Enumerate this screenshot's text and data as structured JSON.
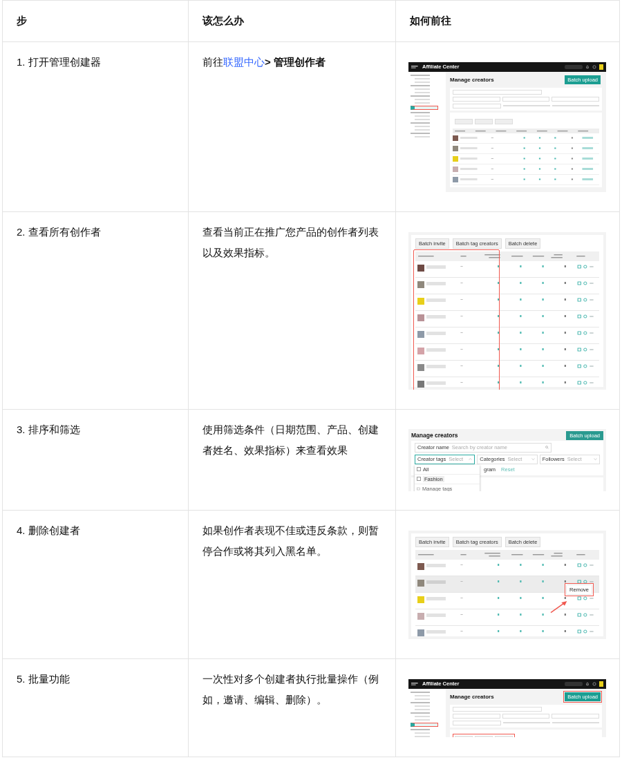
{
  "columns": [
    "步",
    "该怎么办",
    "如何前往"
  ],
  "rows": [
    {
      "step": "1. 打开管理创建器",
      "instruction": [
        {
          "kind": "text",
          "text": "前往"
        },
        {
          "kind": "link",
          "text": "联盟中心"
        },
        {
          "kind": "bold",
          "text": "> 管理创作者"
        }
      ],
      "preview": {
        "kind": "page",
        "brand": "Affiliate Center",
        "title": "Manage creators",
        "button": "Batch upload",
        "mark_sidebar": true,
        "creators": [
          {
            "color": "#7d5a50"
          },
          {
            "color": "#8f887c"
          },
          {
            "color": "#e8cf1a"
          },
          {
            "color": "#c8aeb0"
          },
          {
            "color": "#8e9aa8"
          }
        ]
      }
    },
    {
      "step": "2. 查看所有创作者",
      "instruction": [
        {
          "kind": "text",
          "text": "查看当前正在推广您产品的创作者列表以及效果指标。"
        }
      ],
      "preview": {
        "kind": "table",
        "batch_buttons": [
          "Batch invite",
          "Batch tag creators",
          "Batch delete"
        ],
        "mark_columns": true,
        "creators": [
          {
            "color": "#6e4a44",
            "selected": false
          },
          {
            "color": "#8f887c",
            "selected": false
          },
          {
            "color": "#e8cf1a",
            "selected": false
          },
          {
            "color": "#b99297",
            "selected": false
          },
          {
            "color": "#8e9aa8",
            "selected": false
          },
          {
            "color": "#d4a3a8",
            "selected": false
          },
          {
            "color": "#8a8a8a",
            "selected": false
          },
          {
            "color": "#777777",
            "selected": false
          }
        ]
      }
    },
    {
      "step": "3. 排序和筛选",
      "instruction": [
        {
          "kind": "text",
          "text": "使用筛选条件（日期范围、产品、创建者姓名、效果指标）来查看效果"
        }
      ],
      "preview": {
        "kind": "filter",
        "title": "Manage creators",
        "button": "Batch upload",
        "search": {
          "label": "Creator name",
          "placeholder": "Search by creator name"
        },
        "selects": [
          {
            "label": "Creator tags",
            "placeholder": "Select",
            "expanded": true
          },
          {
            "label": "Categories",
            "placeholder": "Select",
            "expanded": false
          },
          {
            "label": "Followers",
            "placeholder": "Select",
            "expanded": false
          }
        ],
        "options": [
          {
            "text": "All",
            "checked": false
          },
          {
            "text": "Fashion",
            "checked": false
          }
        ],
        "manage": "Manage tags",
        "peek": "gram",
        "reset": "Reset"
      }
    },
    {
      "step": "4. 删除创建者",
      "instruction": [
        {
          "kind": "text",
          "text": "如果创作者表现不佳或违反条款，则暂停合作或将其列入黑名单。"
        }
      ],
      "preview": {
        "kind": "table",
        "batch_buttons": [
          "Batch invite",
          "Batch tag creators",
          "Batch delete"
        ],
        "menu": "Remove",
        "creators": [
          {
            "color": "#7d5a50",
            "selected": false
          },
          {
            "color": "#8f887c",
            "selected": true
          },
          {
            "color": "#e8cf1a",
            "selected": false
          },
          {
            "color": "#c8aeb0",
            "selected": false
          },
          {
            "color": "#8e9aa8",
            "selected": false
          }
        ]
      }
    },
    {
      "step": "5. 批量功能",
      "instruction": [
        {
          "kind": "text",
          "text": "一次性对多个创建者执行批量操作（例如，邀请、编辑、删除）。"
        }
      ],
      "preview": {
        "kind": "page",
        "brand": "Affiliate Center",
        "title": "Manage creators",
        "button": "Batch upload",
        "mark_sidebar": true,
        "mark_button": true,
        "mark_batch": true
      }
    }
  ]
}
